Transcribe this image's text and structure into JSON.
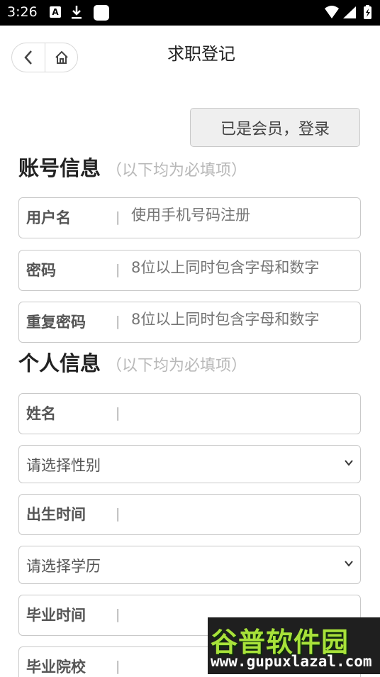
{
  "status_bar": {
    "time": "3:26",
    "icons": [
      "a-notification-icon",
      "download-icon",
      "app-notification-icon",
      "wifi-icon",
      "signal-icon",
      "battery-icon"
    ]
  },
  "nav": {
    "title": "求职登记"
  },
  "login_button": "已是会员，登录",
  "account_section": {
    "title": "账号信息",
    "hint": "（以下均为必填项）"
  },
  "account_fields": [
    {
      "label": "用户名",
      "placeholder": "使用手机号码注册"
    },
    {
      "label": "密码",
      "placeholder": "8位以上同时包含字母和数字"
    },
    {
      "label": "重复密码",
      "placeholder": "8位以上同时包含字母和数字"
    }
  ],
  "personal_section": {
    "title": "个人信息",
    "hint": "（以下均为必填项）"
  },
  "personal_fields": {
    "name_label": "姓名",
    "gender_select": "请选择性别",
    "birth_label": "出生时间",
    "education_select": "请选择学历",
    "graduation_time_label": "毕业时间",
    "school_label": "毕业院校"
  },
  "field_separator": "|",
  "watermark": {
    "main": "谷普软件园",
    "url": "www.gupuxlazal.com"
  }
}
